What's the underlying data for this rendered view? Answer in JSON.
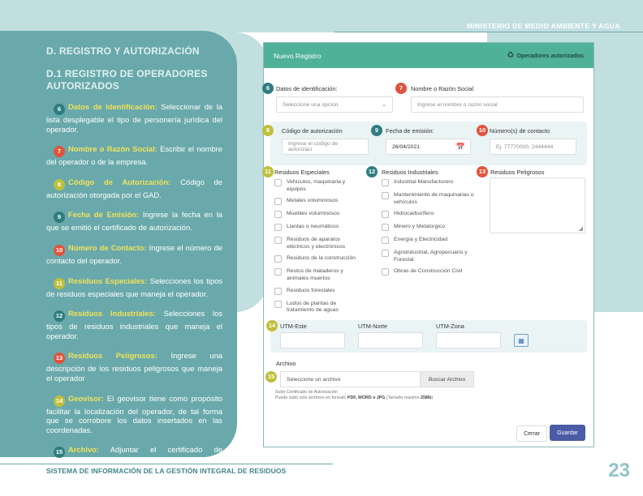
{
  "header": {
    "ministry": "MINISTERIO DE MEDIO AMBIENTE Y AGUA"
  },
  "left": {
    "section_title": "D. REGISTRO Y AUTORIZACIÓN",
    "subsection_title": "D.1 REGISTRO DE OPERADORES AUTORIZADOS",
    "items": [
      {
        "num": "6",
        "key": "Datos de Identificación:",
        "text": " Seleccionar de la lista desplegable el tipo de personería jurídica del operador."
      },
      {
        "num": "7",
        "key": "Nombre o Razón Social:",
        "text": " Escribir el nombre del operador  o de la empresa."
      },
      {
        "num": "8",
        "key": "Código de Autorización:",
        "text": " Código de autorización otorgada por el GAD."
      },
      {
        "num": "9",
        "key": "Fecha de Emisión:",
        "text": " Ingrese la fecha en la que se emitió el certificado de autorización."
      },
      {
        "num": "10",
        "key": "Número de Contacto:",
        "text": " Ingrese el número de contacto del operador."
      },
      {
        "num": "11",
        "key": "Residuos Especiales:",
        "text": " Selecciones los tipos de residuos especiales que maneja el operador."
      },
      {
        "num": "12",
        "key": "Residuos Industriales:",
        "text": " Selecciones los tipos de residuos industriales que maneja el operador."
      },
      {
        "num": "13",
        "key": "Residuos Peligrosos:",
        "text": " Ingrese una descripción de los residuos peligrosos que maneja el operador"
      },
      {
        "num": "14",
        "key": "Geovisor:",
        "text": " El geovisor tiene como propósito facilitar la localización del operador, de tal forma que se corrobore los datos insertados en las coordenadas."
      },
      {
        "num": "15",
        "key": "Archivo:",
        "text": " Adjuntar el certificado de autorización del operador."
      }
    ]
  },
  "form": {
    "title": "Nuevo Registro",
    "header_right": "Operadores autorizados",
    "identificacion_label": "Datos de identificación:",
    "identificacion_placeholder": "Seleccione una opción",
    "razon_label": "Nombre o Razón Social",
    "razon_placeholder": "Ingrese el nombre o razón social",
    "codigo_label": "Código de autorización",
    "codigo_placeholder": "Ingrese el código de autorizaci",
    "fecha_label": "Fecha de emisión:",
    "fecha_value": "26/04/2021",
    "contacto_label": "Número(s) de contacto",
    "contacto_placeholder": "Ej. 77770000, 2444444",
    "especiales_label": "Residuos Especiales",
    "especiales": [
      "Vehículos, maquinaria y equipos",
      "Metales voluminosos",
      "Muebles voluminosos",
      "Llantas o neumáticos",
      "Residuos de aparatos eléctricos y electrónicos",
      "Residuos de la construcción",
      "Restos de mataderos y animales muertos",
      "Residuos forestales",
      "Lodos de plantas de tratamiento de aguas"
    ],
    "industriales_label": "Residuos Industriales",
    "industriales": [
      "Industrial Manufacturero",
      "Mantenimiento de maquinarias o vehículos",
      "Hidrocarburífero",
      "Minero y Metalúrgico",
      "Energía y Electricidad",
      "Agroindustrial, Agropecuario y Forestal",
      "Obras de Construcción Civil"
    ],
    "peligrosos_label": "Residuos Peligrosos",
    "utm_este": "UTM-Este",
    "utm_norte": "UTM-Norte",
    "utm_zona": "UTM-Zona",
    "archivo_label": "Archivo",
    "archivo_placeholder": "Seleccione un archivo",
    "buscar_label": "Buscar Archivo",
    "hint_line1": "Subir Certificado de Autorización",
    "hint_pre": "Puede subir solo archivos en formato ",
    "hint_formats": "PDF, WORD o JPG",
    "hint_mid": " (Tamaño máximo ",
    "hint_size": "25Mb",
    "hint_end": ")",
    "cancel_label": "Cerrar",
    "save_label": "Guardar"
  },
  "footer": {
    "text": "SISTEMA DE  INFORMACIÓN DE LA GESTIÓN INTEGRAL DE RESIDUOS",
    "page": "23"
  },
  "colors": {
    "teal_badge": "#2f7d81",
    "red_badge": "#e0533d",
    "yellow_badge": "#bfbf3c",
    "header_green": "#4fb197",
    "save_blue": "#4c5ba6"
  }
}
